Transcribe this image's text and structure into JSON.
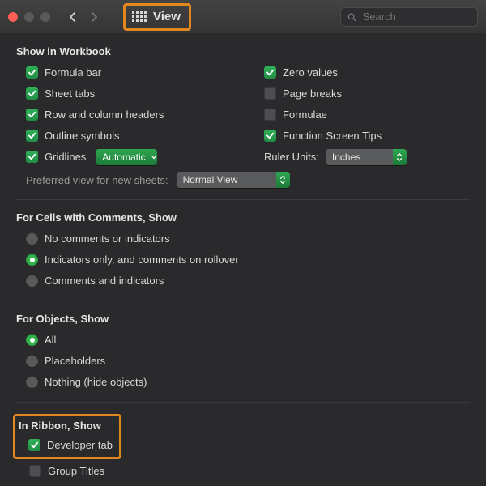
{
  "header": {
    "title": "View",
    "search_placeholder": "Search"
  },
  "sections": {
    "show_in_workbook": {
      "title": "Show in Workbook",
      "left": [
        {
          "label": "Formula bar",
          "checked": true
        },
        {
          "label": "Sheet tabs",
          "checked": true
        },
        {
          "label": "Row and column headers",
          "checked": true
        },
        {
          "label": "Outline symbols",
          "checked": true
        }
      ],
      "gridlines": {
        "label": "Gridlines",
        "checked": true,
        "select_value": "Automatic"
      },
      "right": [
        {
          "label": "Zero values",
          "checked": true
        },
        {
          "label": "Page breaks",
          "checked": false
        },
        {
          "label": "Formulae",
          "checked": false
        },
        {
          "label": "Function Screen Tips",
          "checked": true
        }
      ],
      "ruler": {
        "label": "Ruler Units:",
        "select_value": "Inches"
      },
      "preferred_view": {
        "label": "Preferred view for new sheets:",
        "select_value": "Normal View"
      }
    },
    "comments": {
      "title": "For Cells with Comments, Show",
      "options": [
        {
          "label": "No comments or indicators",
          "selected": false
        },
        {
          "label": "Indicators only, and comments on rollover",
          "selected": true
        },
        {
          "label": "Comments and indicators",
          "selected": false
        }
      ]
    },
    "objects": {
      "title": "For Objects, Show",
      "options": [
        {
          "label": "All",
          "selected": true
        },
        {
          "label": "Placeholders",
          "selected": false
        },
        {
          "label": "Nothing (hide objects)",
          "selected": false
        }
      ]
    },
    "ribbon": {
      "title": "In Ribbon, Show",
      "developer": {
        "label": "Developer tab",
        "checked": true
      },
      "group_titles": {
        "label": "Group Titles",
        "checked": false
      }
    }
  }
}
